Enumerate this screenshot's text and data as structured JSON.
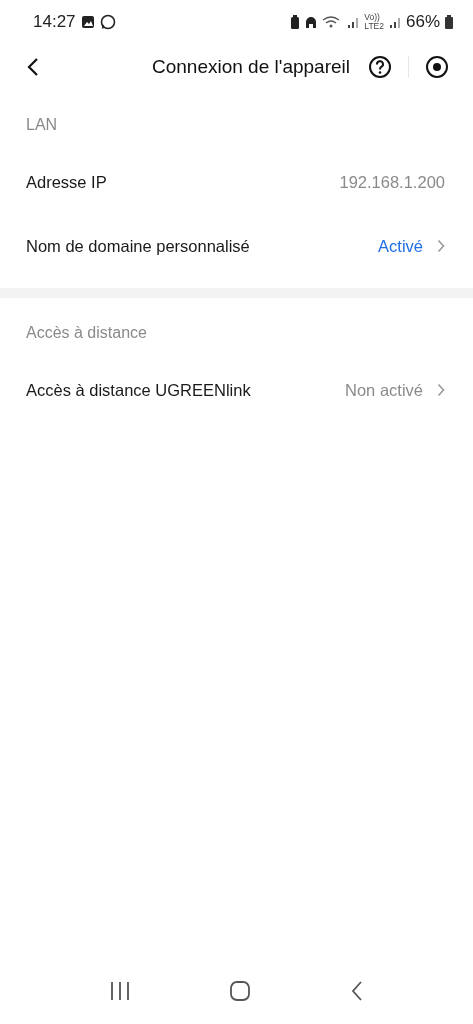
{
  "status_bar": {
    "time": "14:27",
    "volte": [
      "Vo))",
      "LTE2"
    ],
    "battery": "66%"
  },
  "header": {
    "title": "Connexion de l'appareil"
  },
  "sections": [
    {
      "title": "LAN",
      "rows": [
        {
          "label": "Adresse IP",
          "value": "192.168.1.200",
          "on": false,
          "chevron": false
        },
        {
          "label": "Nom de domaine personnalisé",
          "value": "Activé",
          "on": true,
          "chevron": true
        }
      ]
    },
    {
      "title": "Accès à distance",
      "rows": [
        {
          "label": "Accès à distance UGREENlink",
          "value": "Non activé",
          "on": false,
          "chevron": true
        }
      ]
    }
  ]
}
